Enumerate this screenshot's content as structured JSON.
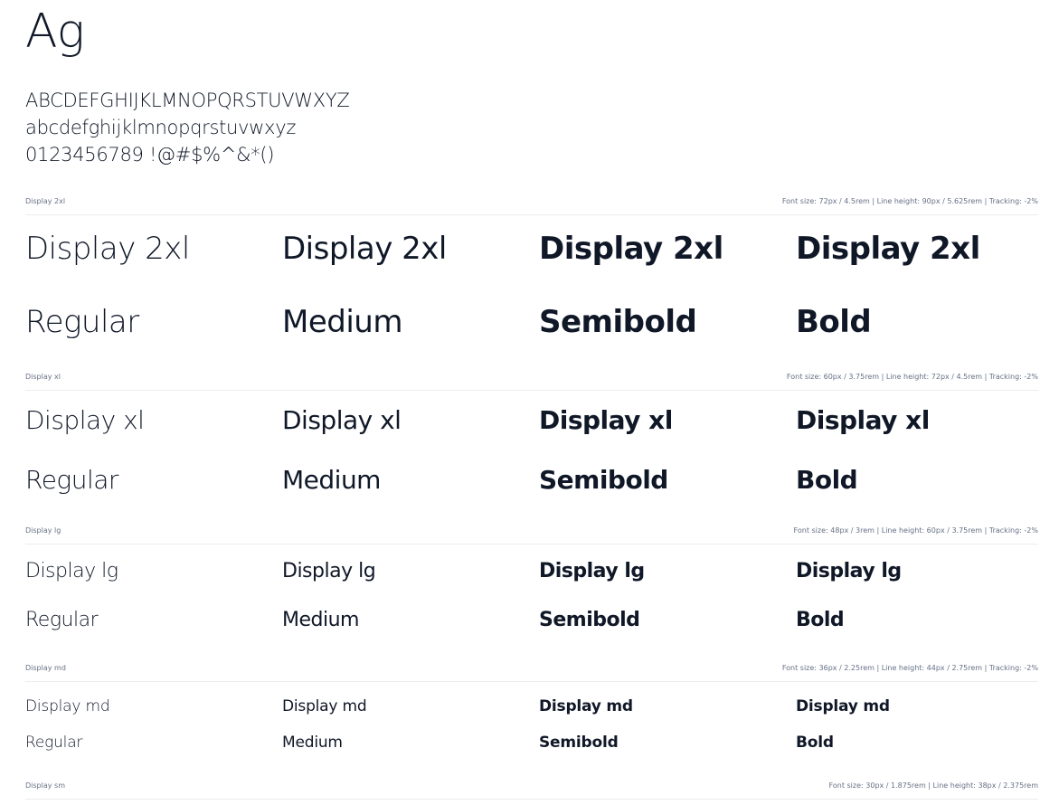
{
  "hero": {
    "glyphs": "Ag"
  },
  "charset": {
    "upper": "ABCDEFGHIJKLMNOPQRSTUVWXYZ",
    "lower": "abcdefghijklmnopqrstuvwxyz",
    "digits": "0123456789 !@#$%^&*()"
  },
  "weights": [
    "Regular",
    "Medium",
    "Semibold",
    "Bold"
  ],
  "sections": [
    {
      "name": "Display 2xl",
      "sample": "Display 2xl",
      "spec": "Font size: 72px / 4.5rem | Line height: 90px / 5.625rem | Tracking: -2%"
    },
    {
      "name": "Display xl",
      "sample": "Display xl",
      "spec": "Font size: 60px / 3.75rem | Line height: 72px / 4.5rem | Tracking: -2%"
    },
    {
      "name": "Display lg",
      "sample": "Display lg",
      "spec": "Font size: 48px / 3rem | Line height: 60px / 3.75rem | Tracking: -2%"
    },
    {
      "name": "Display md",
      "sample": "Display md",
      "spec": "Font size: 36px / 2.25rem | Line height: 44px / 2.75rem | Tracking: -2%"
    },
    {
      "name": "Display sm",
      "sample": "",
      "spec": "Font size: 30px / 1.875rem | Line height: 38px / 2.375rem"
    }
  ],
  "colors": {
    "text": "#101828",
    "muted": "#667085",
    "divider": "#eaecf0"
  }
}
